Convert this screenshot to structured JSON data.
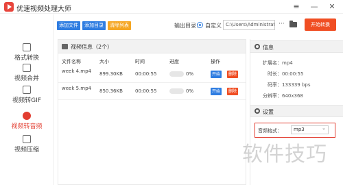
{
  "app": {
    "title": "优速视频处理大师",
    "window_buttons": {
      "menu": "≡",
      "minimize": "—",
      "close": "✕"
    }
  },
  "sidebar": {
    "items": [
      {
        "label": "格式转换",
        "icon": "convert-icon",
        "active": false
      },
      {
        "label": "视频合并",
        "icon": "merge-icon",
        "active": false
      },
      {
        "label": "视频转GIF",
        "icon": "gif-icon",
        "active": false
      },
      {
        "label": "视频转音频",
        "icon": "audio-icon",
        "active": true
      },
      {
        "label": "视频压缩",
        "icon": "compress-icon",
        "active": false
      }
    ]
  },
  "toolbar": {
    "add_file": "添加文件",
    "add_folder": "添加目录",
    "clear_list": "清除列表",
    "output_label": "输出目录：",
    "custom_label": "自定义",
    "output_path": "C:\\Users\\Administrator",
    "more": "···",
    "start": "开始转换"
  },
  "video_panel": {
    "title": "视频信息（2个）",
    "columns": [
      "文件名称",
      "大小",
      "时间",
      "进度",
      "操作"
    ],
    "rows": [
      {
        "name": "week 4.mp4",
        "size": "899.30KB",
        "time": "00:00:55",
        "progress": "0%",
        "start": "开始",
        "delete": "删除"
      },
      {
        "name": "week 5.mp4",
        "size": "850.36KB",
        "time": "00:00:55",
        "progress": "0%",
        "start": "开始",
        "delete": "删除"
      }
    ]
  },
  "info_panel": {
    "title": "信息",
    "fields": [
      {
        "key": "扩展名：",
        "value": "mp4"
      },
      {
        "key": "时长：",
        "value": "00:00:55"
      },
      {
        "key": "码率：",
        "value": "133339 bps"
      },
      {
        "key": "分辨率：",
        "value": "640x368"
      }
    ]
  },
  "settings_panel": {
    "title": "设置",
    "audio_format_label": "音频格式：",
    "audio_format_value": "mp3"
  },
  "watermark": "软件技巧",
  "colors": {
    "accent": "#f04e23",
    "primary": "#2f7de1",
    "warning": "#f5a623",
    "highlight": "#e23d30"
  }
}
